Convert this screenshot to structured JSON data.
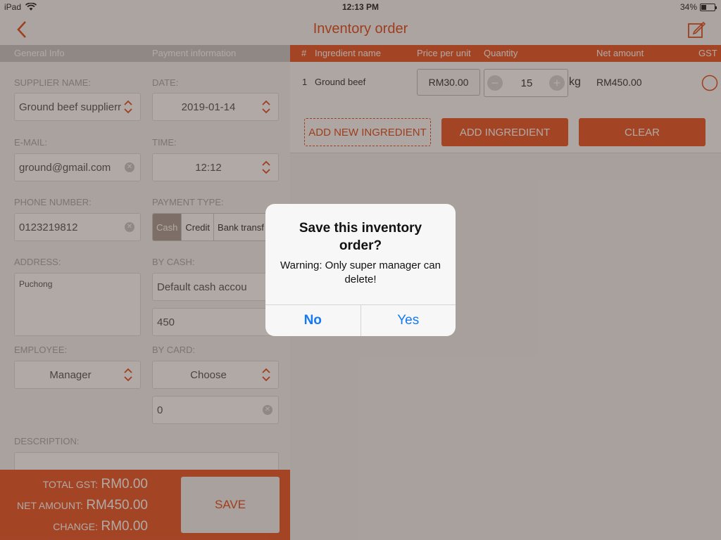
{
  "status": {
    "device": "iPad",
    "time": "12:13 PM",
    "battery": "34%",
    "battery_level": 0.34
  },
  "nav": {
    "title": "Inventory order"
  },
  "left": {
    "section_general": "General Info",
    "section_payment": "Payment information",
    "supplier_label": "SUPPLIER NAME:",
    "supplier_value": "Ground beef supplierr",
    "date_label": "DATE:",
    "date_value": "2019-01-14",
    "email_label": "E-MAIL:",
    "email_value": "ground@gmail.com",
    "time_label": "TIME:",
    "time_value": "12:12",
    "phone_label": "PHONE NUMBER:",
    "phone_value": "0123219812",
    "payment_type_label": "PAYMENT TYPE:",
    "payment_options": [
      "Cash",
      "Credit",
      "Bank transf"
    ],
    "address_label": "ADDRESS:",
    "address_value": "Puchong",
    "by_cash_label": "BY CASH:",
    "cash_account": "Default cash accou",
    "cash_amount": "450",
    "employee_label": "EMPLOYEE:",
    "employee_value": "Manager",
    "by_card_label": "BY CARD:",
    "card_choice": "Choose",
    "card_amount": "0",
    "description_label": "DESCRIPTION:"
  },
  "summary": {
    "gst_label": "TOTAL GST:",
    "gst_value": "RM0.00",
    "net_label": "NET AMOUNT:",
    "net_value": "RM450.00",
    "change_label": "CHANGE:",
    "change_value": "RM0.00",
    "save_label": "SAVE"
  },
  "table": {
    "headers": {
      "num": "#",
      "name": "Ingredient name",
      "price": "Price per unit",
      "qty": "Quantity",
      "net": "Net amount",
      "gst": "GST"
    },
    "row": {
      "num": "1",
      "name": "Ground beef",
      "price": "RM30.00",
      "qty": "15",
      "unit": "kg",
      "net": "RM450.00"
    },
    "add_new_label": "ADD NEW INGREDIENT",
    "add_label": "ADD INGREDIENT",
    "clear_label": "CLEAR"
  },
  "alert": {
    "title": "Save this inventory order?",
    "message": "Warning: Only super manager can delete!",
    "no_label": "No",
    "yes_label": "Yes"
  }
}
